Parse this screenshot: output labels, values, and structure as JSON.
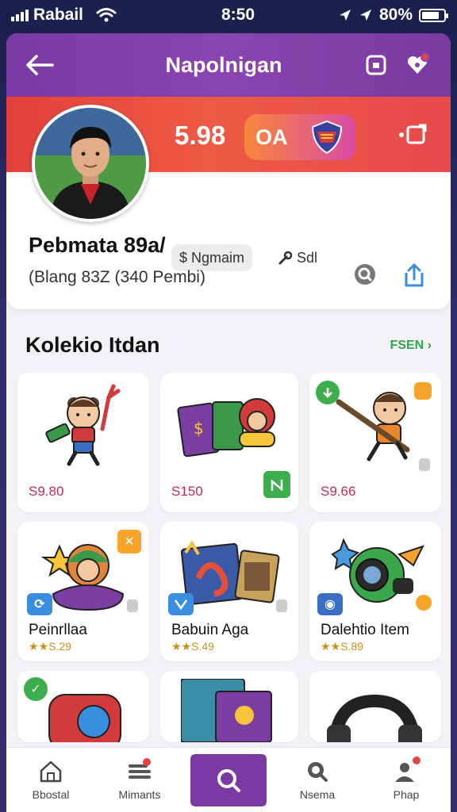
{
  "status": {
    "carrier": "Rabail",
    "time": "8:50",
    "battery": "80%",
    "battery_level": 0.8
  },
  "header": {
    "title": "Napolnigan"
  },
  "profile": {
    "stat_value": "5.98",
    "stat_pill_label": "OA",
    "tags": [
      "$ Ngmaim",
      "Sdl"
    ],
    "name": "Pebmata 89a/",
    "subtitle": "(Blang 83Z (340 Pembi)"
  },
  "section": {
    "title": "Kolekio Itdan",
    "see_all": "FSEN"
  },
  "items": [
    {
      "price": "S9.80",
      "name": "",
      "rating": ""
    },
    {
      "price": "S150",
      "name": "",
      "rating": ""
    },
    {
      "price": "S9.66",
      "name": "",
      "rating": ""
    },
    {
      "price": "",
      "name": "Peinrllaa",
      "rating": "★★S.29"
    },
    {
      "price": "",
      "name": "Babuin Aga",
      "rating": "★★S.49"
    },
    {
      "price": "",
      "name": "Dalehtio Item",
      "rating": "★★S.89"
    }
  ],
  "nav": [
    {
      "label": "Bbostal"
    },
    {
      "label": "Mimants"
    },
    {
      "label": ""
    },
    {
      "label": "Nsema"
    },
    {
      "label": "Phap"
    }
  ]
}
